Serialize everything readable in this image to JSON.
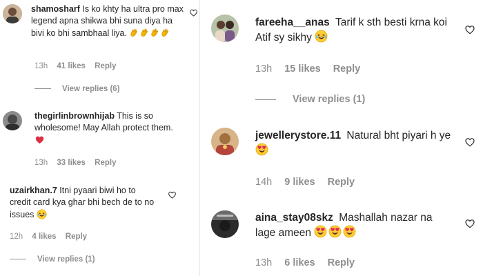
{
  "left_panel": {
    "comments": [
      {
        "username": "shamosharf",
        "text": "Is ko khty ha ultra pro max legend apna shikwa bhi suna diya ha bivi ko bhi sambhaal liya.",
        "emoji": "clapping-hands x4",
        "time": "13h",
        "likes": "41 likes",
        "reply": "Reply",
        "view_replies": "View replies (6)"
      },
      {
        "username": "thegirlinbrownhijab",
        "text": "This is so wholesome! May Allah protect them.",
        "emoji": "red-heart",
        "time": "13h",
        "likes": "33 likes",
        "reply": "Reply"
      },
      {
        "username": "uzairkhan.7",
        "text": "Itni pyaari biwi ho to credit card kya ghar bhi bech de to no issues",
        "emoji": "laughing-face",
        "time": "12h",
        "likes": "4 likes",
        "reply": "Reply",
        "view_replies": "View replies (1)"
      }
    ]
  },
  "right_panel": {
    "comments": [
      {
        "username": "fareeha__anas",
        "text": "Tarif k sth besti krna koi Atif sy sikhy",
        "emoji": "laughing-face",
        "time": "13h",
        "likes": "15 likes",
        "reply": "Reply",
        "view_replies": "View replies (1)"
      },
      {
        "username": "jewellerystore.11",
        "text": "Natural bht piyari h ye",
        "emoji": "heart-eyes",
        "time": "14h",
        "likes": "9 likes",
        "reply": "Reply"
      },
      {
        "username": "aina_stay08skz",
        "text": "Mashallah nazar na lage ameen",
        "emoji": "heart-eyes x3",
        "time": "13h",
        "likes": "6 likes",
        "reply": "Reply"
      }
    ]
  },
  "colors": {
    "text": "#262626",
    "secondary": "#8e8e8e",
    "heart_emoji": "#e0245e",
    "emoji_yellow": "#ffcc33"
  },
  "icons": [
    "heart-outline-icon",
    "clapping-hands-emoji",
    "red-heart-emoji",
    "laughing-face-emoji",
    "heart-eyes-emoji"
  ]
}
